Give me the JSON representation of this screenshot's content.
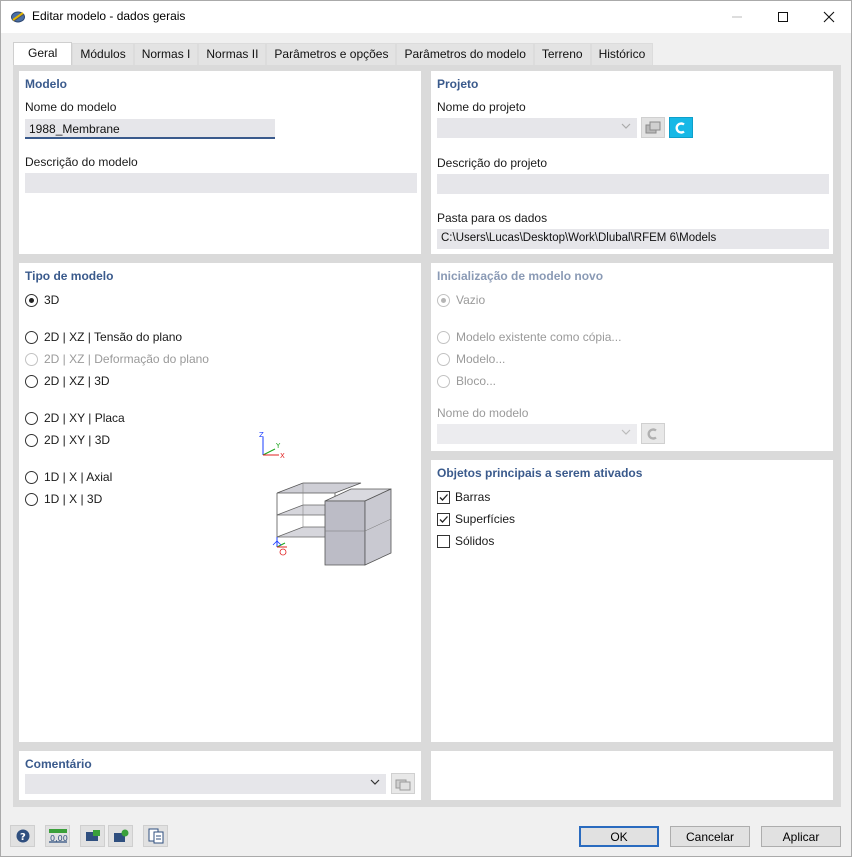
{
  "window": {
    "title": "Editar modelo - dados gerais",
    "minimize_icon": "minimize-icon",
    "maximize_icon": "maximize-icon",
    "close_icon": "close-icon"
  },
  "tabs": [
    {
      "label": "Geral",
      "active": true
    },
    {
      "label": "Módulos"
    },
    {
      "label": "Normas I"
    },
    {
      "label": "Normas II"
    },
    {
      "label": "Parâmetros e opções"
    },
    {
      "label": "Parâmetros do modelo"
    },
    {
      "label": "Terreno"
    },
    {
      "label": "Histórico"
    }
  ],
  "modelo": {
    "title": "Modelo",
    "name_label": "Nome do modelo",
    "name_value": "1988_Membrane",
    "desc_label": "Descrição do modelo",
    "desc_value": ""
  },
  "projeto": {
    "title": "Projeto",
    "name_label": "Nome do projeto",
    "name_value": "",
    "desc_label": "Descrição do projeto",
    "desc_value": "",
    "folder_label": "Pasta para os dados",
    "folder_value": "C:\\Users\\Lucas\\Desktop\\Work\\Dlubal\\RFEM 6\\Models"
  },
  "tipo": {
    "title": "Tipo de modelo",
    "options": [
      {
        "label": "3D",
        "checked": true,
        "enabled": true
      },
      {
        "label": "2D | XZ | Tensão do plano",
        "enabled": true
      },
      {
        "label": "2D | XZ | Deformação do plano",
        "enabled": false
      },
      {
        "label": "2D | XZ | 3D",
        "enabled": true
      },
      {
        "label": "2D | XY | Placa",
        "enabled": true
      },
      {
        "label": "2D | XY | 3D",
        "enabled": true
      },
      {
        "label": "1D | X | Axial",
        "enabled": true
      },
      {
        "label": "1D | X | 3D",
        "enabled": true
      }
    ],
    "axes": {
      "z": "Z",
      "y": "Y",
      "x": "X"
    }
  },
  "inicializacao": {
    "title": "Inicialização de modelo novo",
    "options": [
      {
        "label": "Vazio",
        "checked": true
      },
      {
        "label": "Modelo existente como cópia..."
      },
      {
        "label": "Modelo..."
      },
      {
        "label": "Bloco..."
      }
    ],
    "name_label": "Nome do modelo",
    "name_value": ""
  },
  "objetos": {
    "title": "Objetos principais a serem ativados",
    "items": [
      {
        "label": "Barras",
        "checked": true
      },
      {
        "label": "Superfícies",
        "checked": true
      },
      {
        "label": "Sólidos",
        "checked": false
      }
    ]
  },
  "comentario": {
    "title": "Comentário",
    "value": ""
  },
  "footer": {
    "ok": "OK",
    "cancel": "Cancelar",
    "apply": "Aplicar",
    "tool_icons": [
      "help-icon",
      "units-icon",
      "program-icon",
      "settings-icon",
      "report-icon"
    ],
    "units_text": "0,00"
  },
  "colors": {
    "accent": "#3a5a8c",
    "blue_button": "#16b8e6",
    "panel": "#ffffff",
    "content_bg": "#dadada"
  }
}
